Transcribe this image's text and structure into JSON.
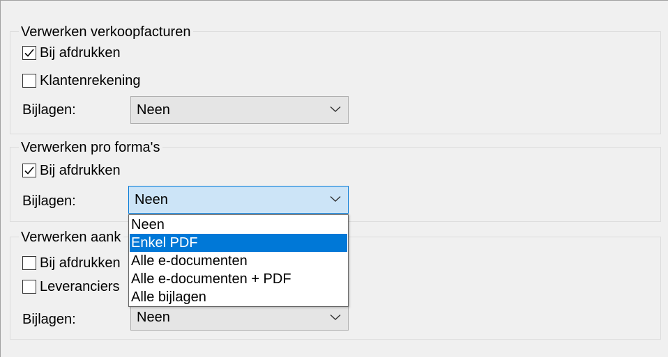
{
  "sales": {
    "legend": "Verwerken verkoopfacturen",
    "print": {
      "label": "Bij afdrukken",
      "checked": true
    },
    "customer_account": {
      "label": "Klantenrekening",
      "checked": false
    },
    "attachments": {
      "label": "Bijlagen:",
      "value": "Neen"
    }
  },
  "proforma": {
    "legend": "Verwerken pro forma's",
    "print": {
      "label": "Bij afdrukken",
      "checked": true
    },
    "attachments": {
      "label": "Bijlagen:",
      "value": "Neen"
    }
  },
  "purchase": {
    "legend": "Verwerken aank",
    "print": {
      "label": "Bij afdrukken",
      "checked": false
    },
    "supplier": {
      "label": "Leveranciers",
      "checked": false
    },
    "attachments": {
      "label": "Bijlagen:",
      "value": "Neen"
    }
  },
  "dropdown": {
    "options": [
      "Neen",
      "Enkel PDF",
      "Alle e-documenten",
      "Alle e-documenten + PDF",
      "Alle bijlagen"
    ],
    "highlighted": "Enkel PDF"
  },
  "colors": {
    "accent": "#0078d7",
    "focused_combo_bg": "#cce4f7",
    "window_bg": "#f0f0f0"
  },
  "icons": {
    "check": "checkmark-icon",
    "chevron": "chevron-down-icon"
  }
}
